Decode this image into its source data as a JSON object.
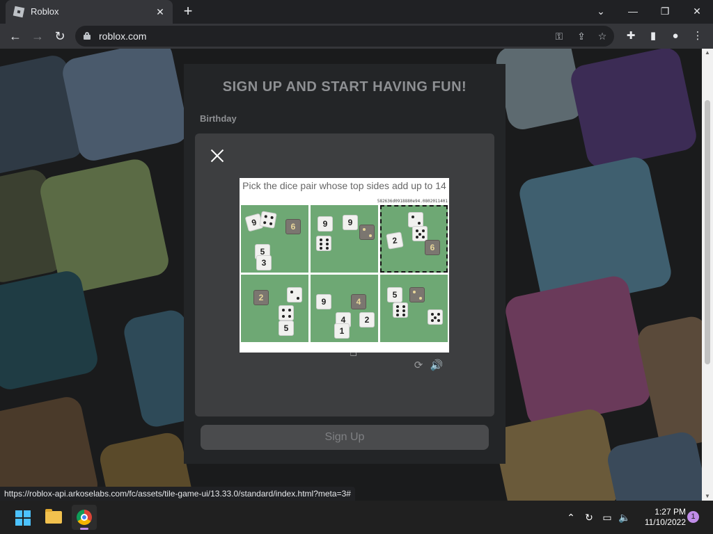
{
  "browser": {
    "tab_title": "Roblox",
    "tab_close": "✕",
    "new_tab": "+",
    "url": "roblox.com",
    "window_controls": {
      "collapse": "⌄",
      "minimize": "—",
      "restore": "❐",
      "close": "✕"
    },
    "status_url": "https://roblox-api.arkoselabs.com/fc/assets/tile-game-ui/13.33.0/standard/index.html?meta=3#"
  },
  "page": {
    "title": "SIGN UP AND START HAVING FUN!",
    "birthday_label": "Birthday",
    "signup_button": "Sign Up"
  },
  "captcha": {
    "prompt": "Pick the dice pair whose top sides add up to 14",
    "code": "582636d0918880e94.0802011401",
    "selected_tile": 3
  },
  "taskbar": {
    "time": "1:27 PM",
    "date": "11/10/2022",
    "notification_count": "1"
  },
  "colors": {
    "page_bg": "#1a1b1c",
    "panel": "#232527",
    "modal": "#3d3e40",
    "captcha_green": "#6ea874",
    "accent": "#c08de8"
  }
}
